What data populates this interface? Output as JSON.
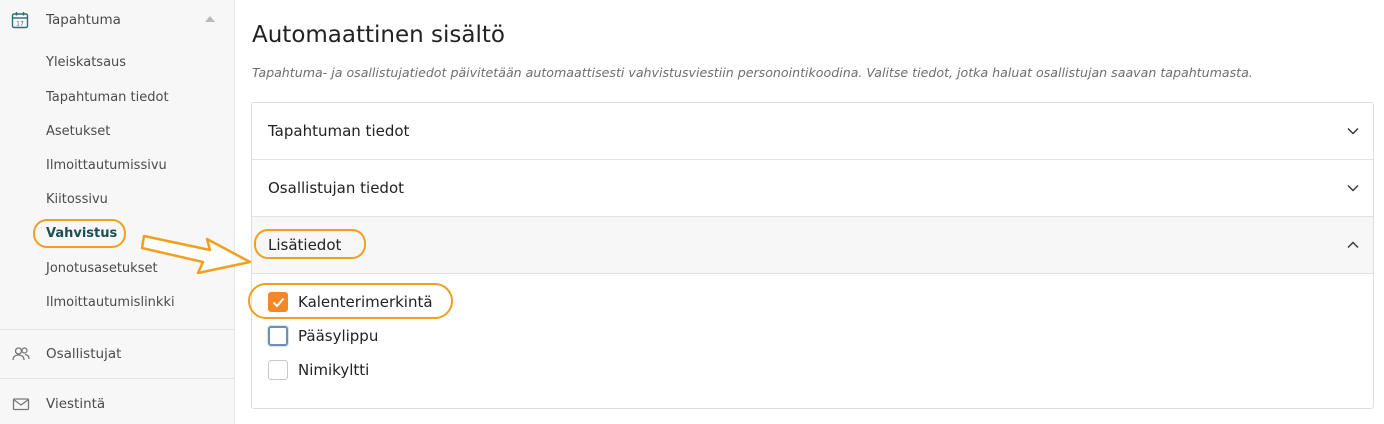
{
  "sidebar": {
    "section_label": "Tapahtuma",
    "section_icon": "calendar-icon",
    "sub_items": [
      {
        "label": "Yleiskatsaus"
      },
      {
        "label": "Tapahtuman tiedot"
      },
      {
        "label": "Asetukset"
      },
      {
        "label": "Ilmoittautumissivu"
      },
      {
        "label": "Kiitossivu"
      },
      {
        "label": "Vahvistus",
        "active": true
      },
      {
        "label": "Jonotusasetukset"
      },
      {
        "label": "Ilmoittautumislinkki"
      }
    ],
    "main_items": [
      {
        "label": "Osallistujat",
        "icon": "users-icon"
      },
      {
        "label": "Viestintä",
        "icon": "mail-icon"
      }
    ]
  },
  "main": {
    "title": "Automaattinen sisältö",
    "description": "Tapahtuma- ja osallistujatiedot päivitetään automaattisesti vahvistusviestiin personointikoodina. Valitse tiedot, jotka haluat osallistujan saavan tapahtumasta.",
    "sections": [
      {
        "label": "Tapahtuman tiedot",
        "expanded": false
      },
      {
        "label": "Osallistujan tiedot",
        "expanded": false
      },
      {
        "label": "Lisätiedot",
        "expanded": true
      }
    ],
    "options": [
      {
        "label": "Kalenterimerkintä",
        "checked": true
      },
      {
        "label": "Pääsylippu",
        "checked": false,
        "focused": true
      },
      {
        "label": "Nimikyltti",
        "checked": false
      }
    ]
  },
  "colors": {
    "accent": "#f2882a",
    "highlight": "#f0a01e",
    "active_nav": "#1b4f54"
  }
}
